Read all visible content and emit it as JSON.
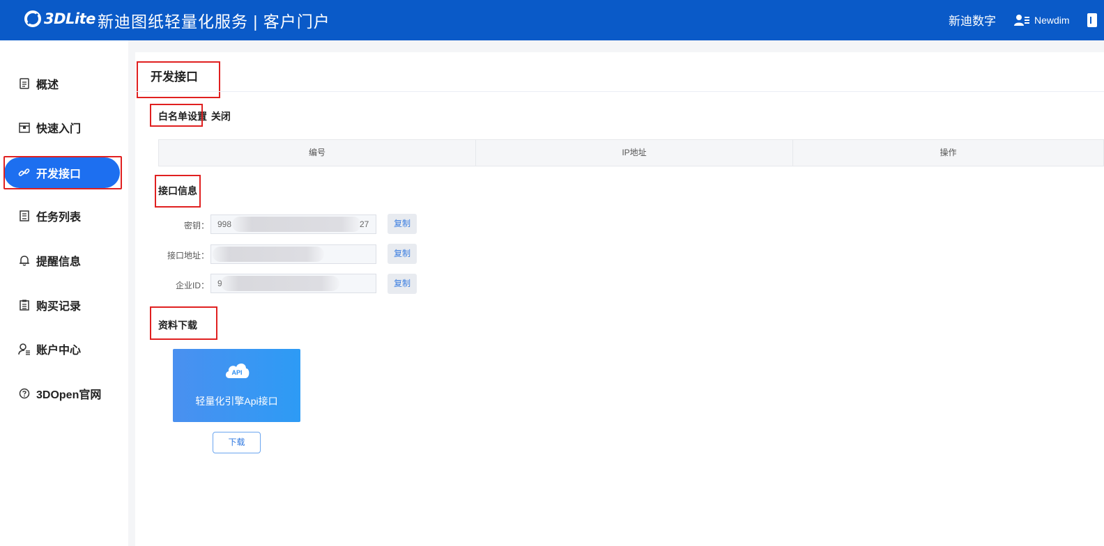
{
  "header": {
    "logo_text": "3DLite",
    "app_title": "新迪图纸轻量化服务 | 客户门户",
    "company": "新迪数字",
    "user_name": "Newdim"
  },
  "sidebar": {
    "items": [
      {
        "label": "概述",
        "icon": "document-icon"
      },
      {
        "label": "快速入门",
        "icon": "box-icon"
      },
      {
        "label": "开发接口",
        "icon": "link-icon",
        "active": true
      },
      {
        "label": "任务列表",
        "icon": "list-icon"
      },
      {
        "label": "提醒信息",
        "icon": "bell-icon"
      },
      {
        "label": "购买记录",
        "icon": "clipboard-icon"
      },
      {
        "label": "账户中心",
        "icon": "user-settings-icon"
      },
      {
        "label": "3DOpen官网",
        "icon": "help-circle-icon"
      }
    ]
  },
  "main": {
    "title": "开发接口",
    "whitelist": {
      "label": "白名单设置",
      "status": "关闭",
      "columns": [
        "编号",
        "IP地址",
        "操作"
      ]
    },
    "api_info": {
      "label": "接口信息",
      "fields": [
        {
          "label": "密钥：",
          "value_start": "998",
          "value_end": "27"
        },
        {
          "label": "接口地址：",
          "value_start": "",
          "value_end": ""
        },
        {
          "label": "企业ID：",
          "value_start": "9",
          "value_end": ""
        }
      ],
      "copy_label": "复制"
    },
    "downloads": {
      "label": "资料下载",
      "card_label": "轻量化引擎Api接口",
      "card_icon_text": "API",
      "download_label": "下载"
    }
  },
  "colors": {
    "header_bg": "#0a5ac8",
    "accent": "#1d6ff0",
    "annotation_red": "#e02020"
  }
}
